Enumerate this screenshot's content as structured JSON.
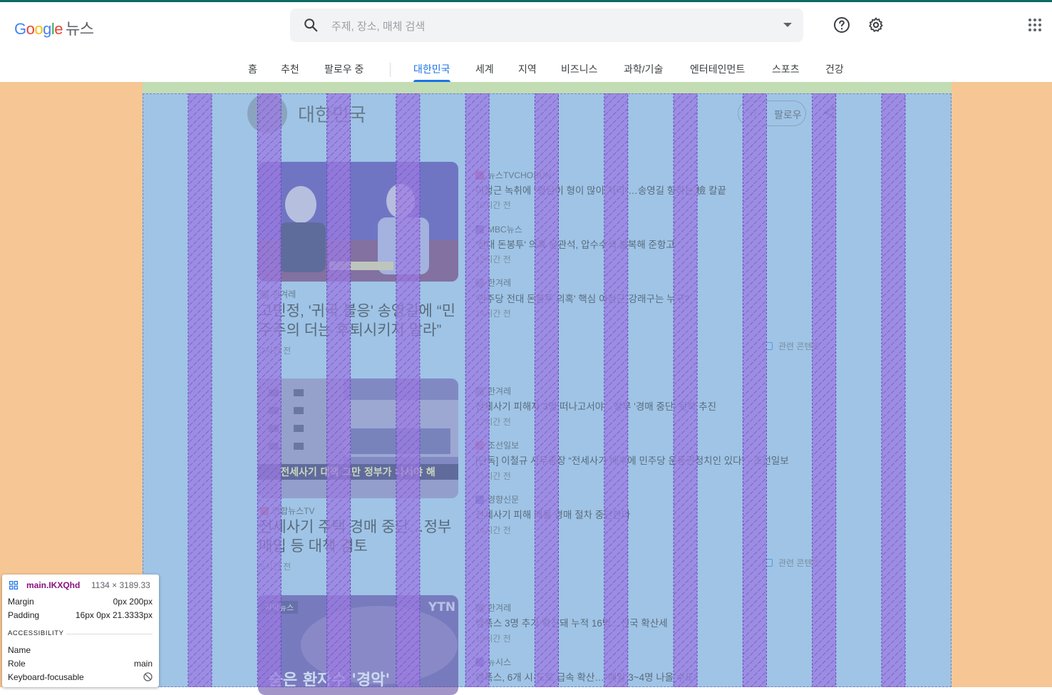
{
  "logo": {
    "g1": "G",
    "g2": "o",
    "g3": "o",
    "g4": "g",
    "g5": "l",
    "g6": "e",
    "product": "뉴스"
  },
  "search": {
    "placeholder": "주제, 장소, 매체 검색"
  },
  "icons": {
    "help": "help-circle-icon",
    "settings": "gear-icon",
    "apps": "apps-grid-icon",
    "search": "search-icon"
  },
  "tabs": [
    "홈",
    "추천",
    "팔로우 중",
    "대한민국",
    "세계",
    "지역",
    "비즈니스",
    "과학/기술",
    "엔터테인먼트",
    "스포츠",
    "건강"
  ],
  "active_tab": "대한민국",
  "section": {
    "title": "대한민국",
    "follow_label": "팔로우"
  },
  "clusters": [
    {
      "main_source": "한겨레",
      "main_title": "고민정, '귀국 불응' 송영길에 “민주주의 더는 후퇴시키지 말라”",
      "main_time": "2시간 전",
      "items": [
        {
          "source": "뉴스TVCHOSUN",
          "title": "이정근 녹취에 “형님이 형이 많이 처리\"…송영길 향하는 檢 칼끝",
          "time": "10시간 전"
        },
        {
          "source": "MBC뉴스",
          "title": "'전대 돈봉투' 의혹 윤관석, 압수수색 불복해 준항고",
          "time": "12시간 전"
        },
        {
          "source": "한겨레",
          "title": "'민주당 전대 돈봉투 의혹' 핵심 이정근·강래구는 누구?",
          "time": "14시간 전"
        }
      ],
      "related": "관련 콘텐츠"
    },
    {
      "main_source": "연합뉴스TV",
      "main_title": "전세사기 주택 경매 중단…정부 매입 등 대책 검토",
      "main_time": "5시간 전",
      "image_text": "전세사기 대책 그만 정부가 나서야 해",
      "items": [
        {
          "source": "한겨레",
          "title": "전세사기 피해자 3명 떠나고서야…정부 '경매 중단' 뒷북 추진",
          "time": "17시간 전"
        },
        {
          "source": "조선일보",
          "title": "[단독] 이철규 사무총장 “전세사기 배후에 민주당 운동권정치인 있다” - 조선일보",
          "time": "21시간 전"
        },
        {
          "source": "경향신문",
          "title": "전세사기 피해 매물 경매 절차 중단한다",
          "time": "14시간 전"
        }
      ],
      "related": "관련 콘텐츠"
    },
    {
      "image_badge": "자막뉴스",
      "image_logo": "YTN",
      "image_caption": "숨은 환자수 '경악'",
      "items": [
        {
          "source": "한겨레",
          "title": "엠폭스 3명 추가 확진돼 누적 16명…전국 확산세",
          "time": "19시간 전"
        },
        {
          "source": "뉴시스",
          "title": "엠폭스, 6개 시·도로 급속 확산…\"매일 3~4명 나올 수도\""
        }
      ]
    }
  ],
  "inspector": {
    "selector": "main.IKXQhd",
    "dimensions": "1134 × 3189.33",
    "margin_label": "Margin",
    "margin_value": "0px 200px",
    "padding_label": "Padding",
    "padding_value": "16px 0px 21.3333px",
    "section_label": "ACCESSIBILITY",
    "name_label": "Name",
    "name_value": "",
    "role_label": "Role",
    "role_value": "main",
    "focus_label": "Keyboard-focusable"
  },
  "colors": {
    "margin_overlay": "#f6c794",
    "padding_overlay": "#c2dcb4",
    "content_overlay": "#9fc4e6",
    "grid_stripe": "#9a7ae0",
    "accent": "#1a73e8"
  }
}
